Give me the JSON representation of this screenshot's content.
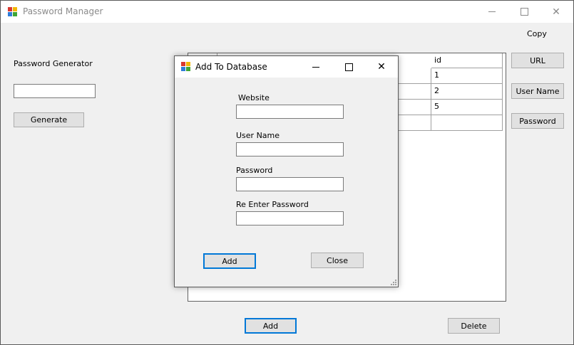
{
  "window": {
    "title": "Password Manager"
  },
  "main": {
    "copy_label": "Copy",
    "generator_label": "Password Generator",
    "generator_value": "",
    "generate_button": "Generate",
    "copy_buttons": {
      "url": "URL",
      "username": "User Name",
      "password": "Password"
    },
    "add_button": "Add",
    "delete_button": "Delete"
  },
  "grid": {
    "column_header": "id",
    "rows": [
      "1",
      "2",
      "5",
      ""
    ]
  },
  "dialog": {
    "title": "Add To Database",
    "website_label": "Website",
    "username_label": "User Name",
    "password_label": "Password",
    "reenter_label": "Re Enter Password",
    "add_button": "Add",
    "close_button": "Close"
  },
  "icons": {
    "app": "app-icon",
    "minimize": "minimize-icon",
    "maximize": "maximize-icon",
    "close": "close-icon"
  }
}
